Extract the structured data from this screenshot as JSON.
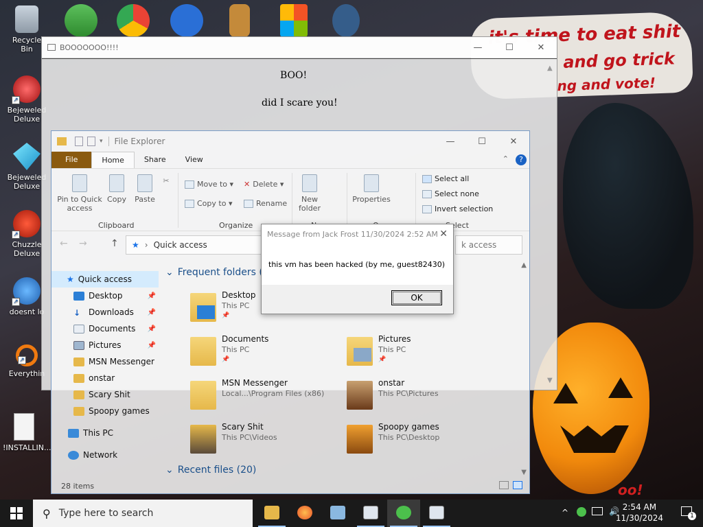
{
  "wallpaper": {
    "line1": "it's time to eat shit",
    "line2": "and go trick",
    "line3": "ng and vote!",
    "footer": "oo!"
  },
  "desktop": {
    "icons": [
      {
        "label": "Recycle Bin"
      },
      {
        "label": "Bejeweled Deluxe"
      },
      {
        "label": "Bejeweled Deluxe"
      },
      {
        "label": "Chuzzle Deluxe"
      },
      {
        "label": "doesnt lo"
      },
      {
        "label": "Everythin"
      },
      {
        "label": "!INSTALLIN..."
      }
    ]
  },
  "boo_window": {
    "title": "BOOOOOOO!!!!",
    "heading": "BOO!",
    "text": "did I scare you!",
    "controls": {
      "minimize": "—",
      "maximize": "☐",
      "close": "✕"
    }
  },
  "explorer": {
    "title": "File Explorer",
    "tabs": {
      "file": "File",
      "home": "Home",
      "share": "Share",
      "view": "View"
    },
    "ribbon": {
      "pin": "Pin to Quick access",
      "copy": "Copy",
      "paste": "Paste",
      "move_to": "Move to",
      "copy_to": "Copy to",
      "delete": "Delete",
      "rename": "Rename",
      "new_folder": "New folder",
      "properties": "Properties",
      "select_all": "Select all",
      "select_none": "Select none",
      "invert_selection": "Invert selection",
      "group_clipboard": "Clipboard",
      "group_organize": "Organize",
      "group_new": "New",
      "group_open": "Open",
      "group_select": "Select"
    },
    "address": "Quick access",
    "search_placeholder": "k access",
    "nav": [
      {
        "label": "Quick access",
        "selected": true,
        "pin": false
      },
      {
        "label": "Desktop",
        "pin": true
      },
      {
        "label": "Downloads",
        "pin": true
      },
      {
        "label": "Documents",
        "pin": true
      },
      {
        "label": "Pictures",
        "pin": true
      },
      {
        "label": "MSN Messenger",
        "pin": false
      },
      {
        "label": "onstar",
        "pin": false
      },
      {
        "label": "Scary Shit",
        "pin": false
      },
      {
        "label": "Spoopy games",
        "pin": false
      },
      {
        "label": "This PC",
        "pin": false
      },
      {
        "label": "Network",
        "pin": false
      }
    ],
    "frequent_header": "Frequent folders (8",
    "recent_header": "Recent files (20)",
    "folders": [
      {
        "name": "Desktop",
        "path": "This PC"
      },
      {
        "name": "Documents",
        "path": "This PC"
      },
      {
        "name": "Pictures",
        "path": "This PC"
      },
      {
        "name": "MSN Messenger",
        "path": "Local...\\Program Files (x86)"
      },
      {
        "name": "onstar",
        "path": "This PC\\Pictures"
      },
      {
        "name": "Scary Shit",
        "path": "This PC\\Videos"
      },
      {
        "name": "Spoopy games",
        "path": "This PC\\Desktop"
      }
    ],
    "status": "28 items"
  },
  "message_box": {
    "title": "Message from Jack Frost 11/30/2024 2:52 AM",
    "text": "this vm has been hacked (by me, guest82430)",
    "ok": "OK"
  },
  "taskbar": {
    "search_placeholder": "Type here to search",
    "time": "2:54 AM",
    "date": "11/30/2024",
    "notification_count": "1"
  },
  "colors": {
    "file_tab": "#8a5a10",
    "taskbar": "#1a1a1a",
    "accent": "#1a73e8"
  }
}
